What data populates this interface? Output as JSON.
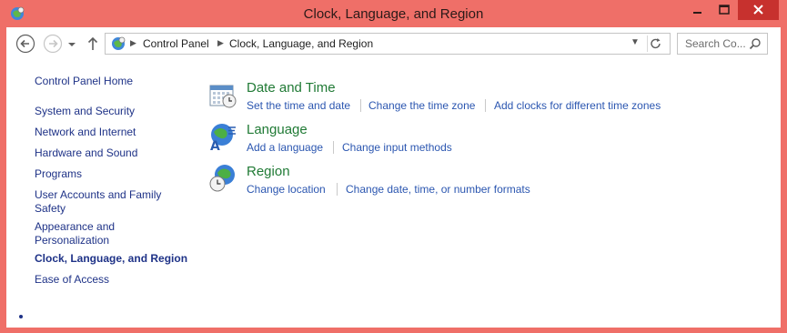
{
  "window": {
    "title": "Clock, Language, and Region",
    "colors": {
      "frame": "#ef6f68",
      "close": "#c7312e",
      "link": "#2b56b0",
      "category": "#207a35",
      "nav": "#1e3287"
    }
  },
  "address": {
    "crumbs": [
      "Control Panel",
      "Clock, Language, and Region"
    ]
  },
  "search": {
    "placeholder": "Search Co..."
  },
  "sidebar": {
    "home": "Control Panel Home",
    "items": [
      {
        "label": "System and Security"
      },
      {
        "label": "Network and Internet"
      },
      {
        "label": "Hardware and Sound"
      },
      {
        "label": "Programs"
      },
      {
        "label": "User Accounts and Family Safety"
      },
      {
        "label": "Appearance and Personalization"
      },
      {
        "label": "Clock, Language, and Region",
        "current": true
      },
      {
        "label": "Ease of Access"
      }
    ]
  },
  "categories": [
    {
      "title": "Date and Time",
      "icon": "calendar-clock-icon",
      "links": [
        "Set the time and date",
        "Change the time zone",
        "Add clocks for different time zones"
      ]
    },
    {
      "title": "Language",
      "icon": "language-globe-icon",
      "links": [
        "Add a language",
        "Change input methods"
      ]
    },
    {
      "title": "Region",
      "icon": "region-globe-clock-icon",
      "links": [
        "Change location",
        "Change date, time, or number formats"
      ]
    }
  ]
}
